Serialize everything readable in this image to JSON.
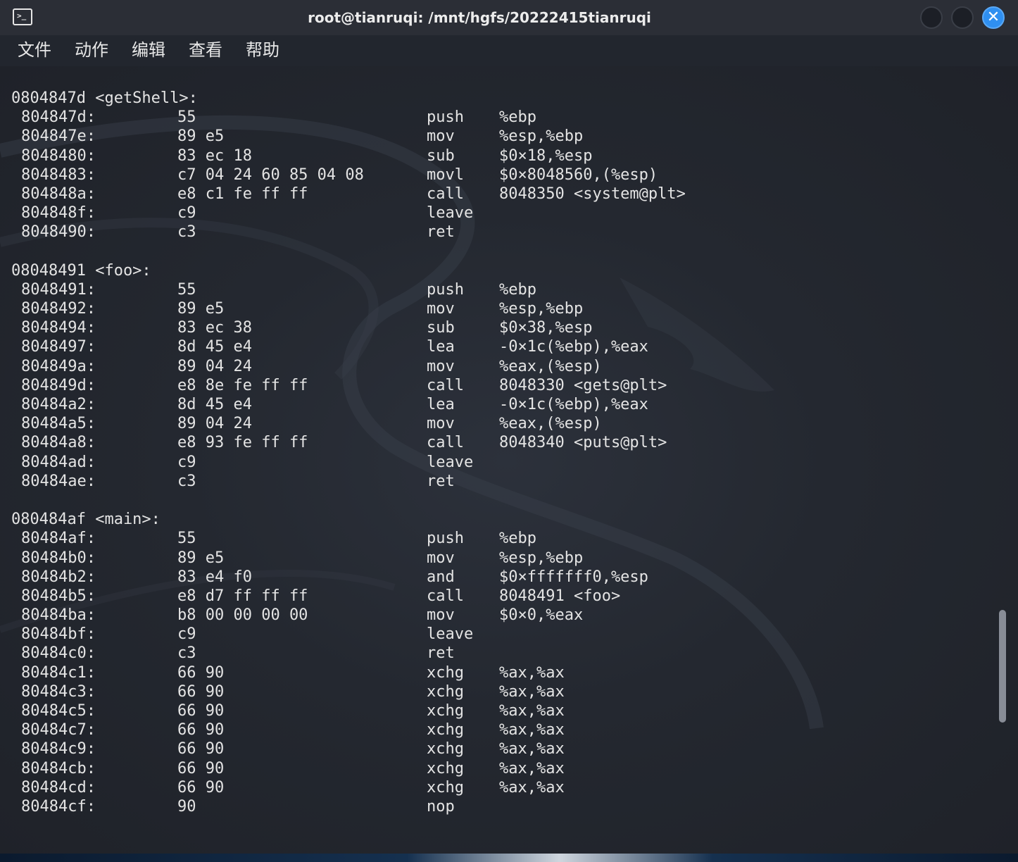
{
  "window": {
    "title": "root@tianruqi: /mnt/hgfs/20222415tianruqi",
    "icon": "terminal-icon",
    "icon_glyph": ">_",
    "close_glyph": "✕"
  },
  "menu": {
    "items": [
      {
        "label": "文件"
      },
      {
        "label": "动作"
      },
      {
        "label": "编辑"
      },
      {
        "label": "查看"
      },
      {
        "label": "帮助"
      }
    ]
  },
  "colors": {
    "background": "#22262e",
    "text": "#e4e4e4",
    "close_button": "#2f8ff0"
  },
  "disassembly": {
    "functions": [
      {
        "header": "0804847d <getShell>:",
        "lines": [
          {
            "addr": "804847d:",
            "bytes": "55",
            "mnem": "push",
            "ops": "%ebp"
          },
          {
            "addr": "804847e:",
            "bytes": "89 e5",
            "mnem": "mov",
            "ops": "%esp,%ebp"
          },
          {
            "addr": "8048480:",
            "bytes": "83 ec 18",
            "mnem": "sub",
            "ops": "$0×18,%esp"
          },
          {
            "addr": "8048483:",
            "bytes": "c7 04 24 60 85 04 08",
            "mnem": "movl",
            "ops": "$0×8048560,(%esp)"
          },
          {
            "addr": "804848a:",
            "bytes": "e8 c1 fe ff ff",
            "mnem": "call",
            "ops": "8048350 <system@plt>"
          },
          {
            "addr": "804848f:",
            "bytes": "c9",
            "mnem": "leave",
            "ops": ""
          },
          {
            "addr": "8048490:",
            "bytes": "c3",
            "mnem": "ret",
            "ops": ""
          }
        ]
      },
      {
        "header": "08048491 <foo>:",
        "lines": [
          {
            "addr": "8048491:",
            "bytes": "55",
            "mnem": "push",
            "ops": "%ebp"
          },
          {
            "addr": "8048492:",
            "bytes": "89 e5",
            "mnem": "mov",
            "ops": "%esp,%ebp"
          },
          {
            "addr": "8048494:",
            "bytes": "83 ec 38",
            "mnem": "sub",
            "ops": "$0×38,%esp"
          },
          {
            "addr": "8048497:",
            "bytes": "8d 45 e4",
            "mnem": "lea",
            "ops": "-0×1c(%ebp),%eax"
          },
          {
            "addr": "804849a:",
            "bytes": "89 04 24",
            "mnem": "mov",
            "ops": "%eax,(%esp)"
          },
          {
            "addr": "804849d:",
            "bytes": "e8 8e fe ff ff",
            "mnem": "call",
            "ops": "8048330 <gets@plt>"
          },
          {
            "addr": "80484a2:",
            "bytes": "8d 45 e4",
            "mnem": "lea",
            "ops": "-0×1c(%ebp),%eax"
          },
          {
            "addr": "80484a5:",
            "bytes": "89 04 24",
            "mnem": "mov",
            "ops": "%eax,(%esp)"
          },
          {
            "addr": "80484a8:",
            "bytes": "e8 93 fe ff ff",
            "mnem": "call",
            "ops": "8048340 <puts@plt>"
          },
          {
            "addr": "80484ad:",
            "bytes": "c9",
            "mnem": "leave",
            "ops": ""
          },
          {
            "addr": "80484ae:",
            "bytes": "c3",
            "mnem": "ret",
            "ops": ""
          }
        ]
      },
      {
        "header": "080484af <main>:",
        "lines": [
          {
            "addr": "80484af:",
            "bytes": "55",
            "mnem": "push",
            "ops": "%ebp"
          },
          {
            "addr": "80484b0:",
            "bytes": "89 e5",
            "mnem": "mov",
            "ops": "%esp,%ebp"
          },
          {
            "addr": "80484b2:",
            "bytes": "83 e4 f0",
            "mnem": "and",
            "ops": "$0×fffffff0,%esp"
          },
          {
            "addr": "80484b5:",
            "bytes": "e8 d7 ff ff ff",
            "mnem": "call",
            "ops": "8048491 <foo>"
          },
          {
            "addr": "80484ba:",
            "bytes": "b8 00 00 00 00",
            "mnem": "mov",
            "ops": "$0×0,%eax"
          },
          {
            "addr": "80484bf:",
            "bytes": "c9",
            "mnem": "leave",
            "ops": ""
          },
          {
            "addr": "80484c0:",
            "bytes": "c3",
            "mnem": "ret",
            "ops": ""
          },
          {
            "addr": "80484c1:",
            "bytes": "66 90",
            "mnem": "xchg",
            "ops": "%ax,%ax"
          },
          {
            "addr": "80484c3:",
            "bytes": "66 90",
            "mnem": "xchg",
            "ops": "%ax,%ax"
          },
          {
            "addr": "80484c5:",
            "bytes": "66 90",
            "mnem": "xchg",
            "ops": "%ax,%ax"
          },
          {
            "addr": "80484c7:",
            "bytes": "66 90",
            "mnem": "xchg",
            "ops": "%ax,%ax"
          },
          {
            "addr": "80484c9:",
            "bytes": "66 90",
            "mnem": "xchg",
            "ops": "%ax,%ax"
          },
          {
            "addr": "80484cb:",
            "bytes": "66 90",
            "mnem": "xchg",
            "ops": "%ax,%ax"
          },
          {
            "addr": "80484cd:",
            "bytes": "66 90",
            "mnem": "xchg",
            "ops": "%ax,%ax"
          },
          {
            "addr": "80484cf:",
            "bytes": "90",
            "mnem": "nop",
            "ops": ""
          }
        ]
      }
    ]
  }
}
